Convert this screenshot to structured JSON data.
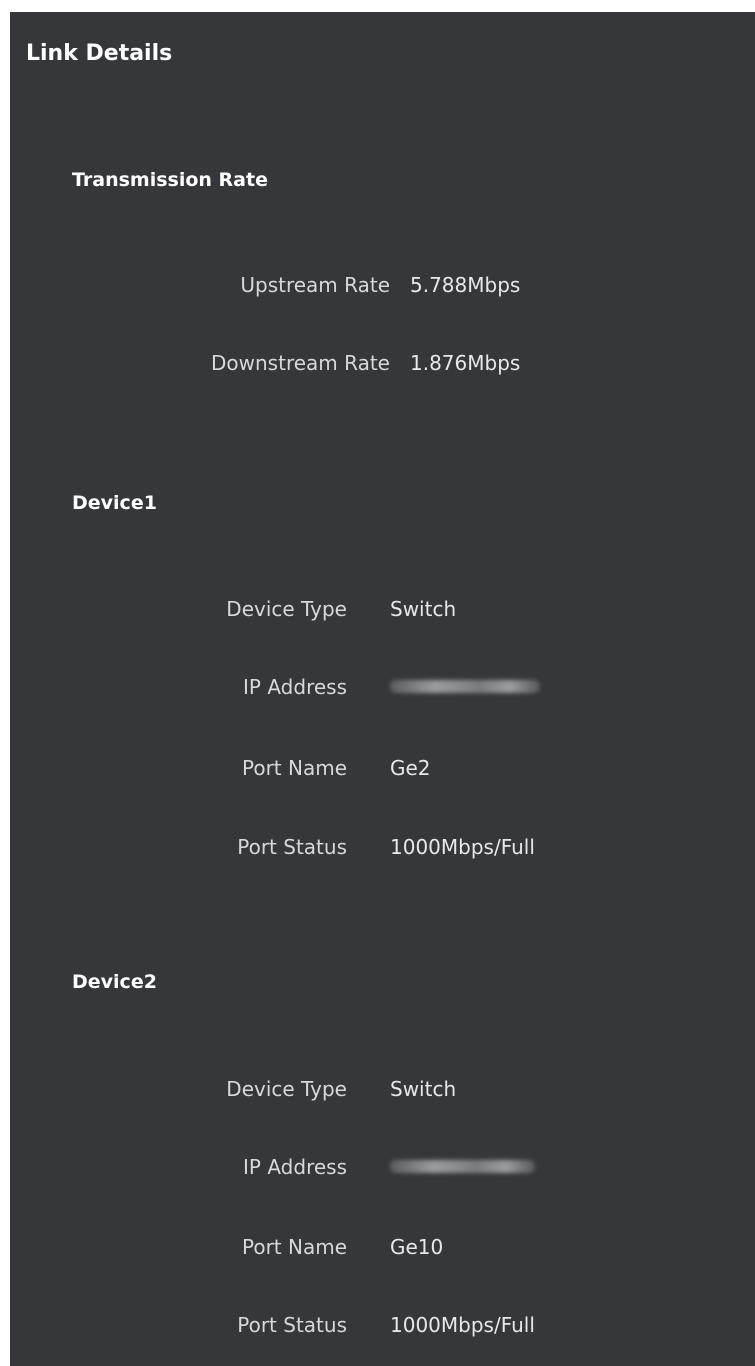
{
  "title": "Link Details",
  "transmission": {
    "heading": "Transmission Rate",
    "upstream_label": "Upstream Rate",
    "upstream_value": "5.788Mbps",
    "downstream_label": "Downstream Rate",
    "downstream_value": "1.876Mbps"
  },
  "devices": [
    {
      "heading": "Device1",
      "type_label": "Device Type",
      "type_value": "Switch",
      "ip_label": "IP Address",
      "port_name_label": "Port Name",
      "port_name_value": "Ge2",
      "port_status_label": "Port Status",
      "port_status_value": "1000Mbps/Full"
    },
    {
      "heading": "Device2",
      "type_label": "Device Type",
      "type_value": "Switch",
      "ip_label": "IP Address",
      "port_name_label": "Port Name",
      "port_name_value": "Ge10",
      "port_status_label": "Port Status",
      "port_status_value": "1000Mbps/Full"
    }
  ]
}
